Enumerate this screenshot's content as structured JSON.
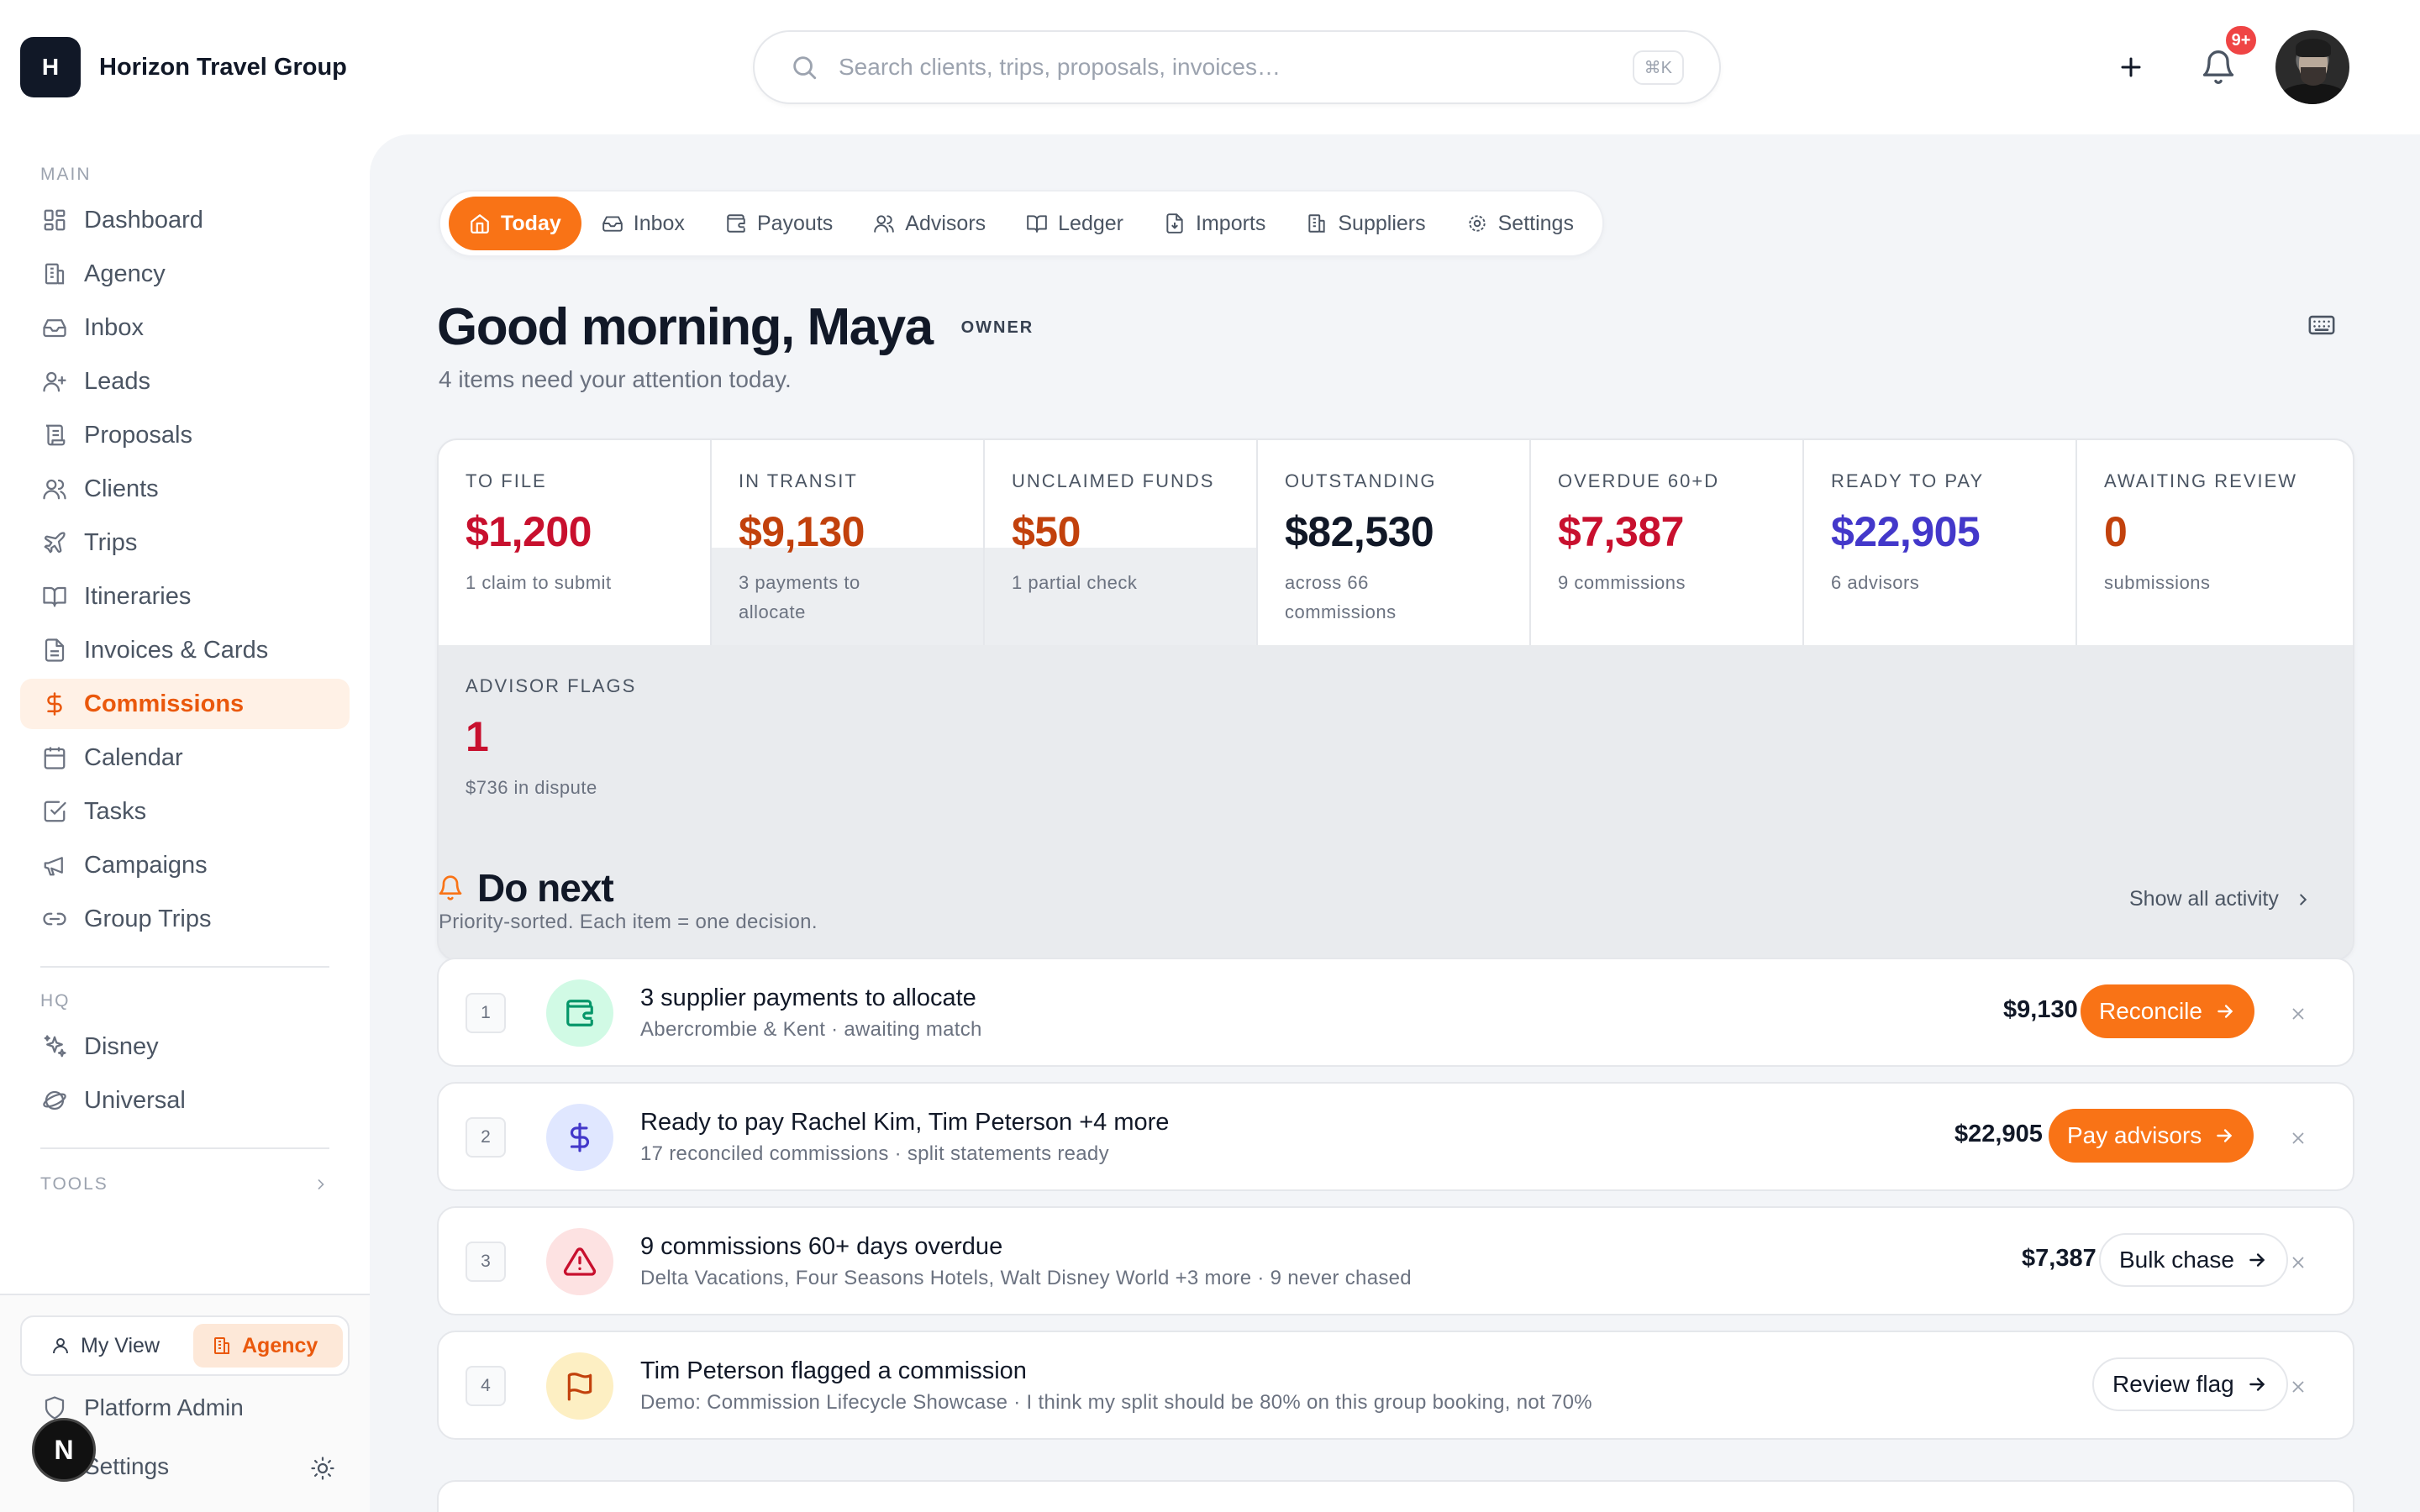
{
  "brand": {
    "logo_letter": "H",
    "name": "Horizon Travel Group"
  },
  "search": {
    "placeholder": "Search clients, trips, proposals, invoices…",
    "shortcut": "⌘K"
  },
  "notifications": {
    "badge": "9+"
  },
  "sidebar": {
    "main_label": "MAIN",
    "items": [
      {
        "label": "Dashboard",
        "icon": "dashboard-icon"
      },
      {
        "label": "Agency",
        "icon": "building-icon"
      },
      {
        "label": "Inbox",
        "icon": "inbox-icon"
      },
      {
        "label": "Leads",
        "icon": "user-plus-icon"
      },
      {
        "label": "Proposals",
        "icon": "scroll-icon"
      },
      {
        "label": "Clients",
        "icon": "users-icon"
      },
      {
        "label": "Trips",
        "icon": "plane-icon"
      },
      {
        "label": "Itineraries",
        "icon": "book-icon"
      },
      {
        "label": "Invoices & Cards",
        "icon": "document-icon"
      },
      {
        "label": "Commissions",
        "icon": "dollar-icon",
        "active": true
      },
      {
        "label": "Calendar",
        "icon": "calendar-icon"
      },
      {
        "label": "Tasks",
        "icon": "checkbox-icon"
      },
      {
        "label": "Campaigns",
        "icon": "megaphone-icon"
      },
      {
        "label": "Group Trips",
        "icon": "link-icon"
      }
    ],
    "hq_label": "HQ",
    "hq_items": [
      {
        "label": "Disney",
        "icon": "sparkles-icon"
      },
      {
        "label": "Universal",
        "icon": "globe-icon"
      }
    ],
    "tools_label": "TOOLS",
    "view_toggle": {
      "my_view": "My View",
      "agency": "Agency"
    },
    "platform_admin": "Platform Admin",
    "settings": "Settings",
    "n_badge": "N"
  },
  "tabs": [
    {
      "label": "Today",
      "icon": "home-icon",
      "active": true
    },
    {
      "label": "Inbox",
      "icon": "inbox-icon"
    },
    {
      "label": "Payouts",
      "icon": "wallet-icon"
    },
    {
      "label": "Advisors",
      "icon": "users-icon"
    },
    {
      "label": "Ledger",
      "icon": "book-icon"
    },
    {
      "label": "Imports",
      "icon": "file-import-icon"
    },
    {
      "label": "Suppliers",
      "icon": "building-icon"
    },
    {
      "label": "Settings",
      "icon": "gear-icon"
    }
  ],
  "greeting": {
    "title": "Good morning, Maya",
    "role": "OWNER",
    "subtitle": "4 items need your attention today."
  },
  "colors": {
    "accent": "#f97316",
    "red": "#c8102e",
    "amber": "#c2410c",
    "indigo": "#4338ca"
  },
  "stats": [
    {
      "label": "TO FILE",
      "value": "$1,200",
      "sub": "1 claim to submit",
      "color": "#c8102e"
    },
    {
      "label": "IN TRANSIT",
      "value": "$9,130",
      "sub": "3 payments to allocate",
      "color": "#c2410c"
    },
    {
      "label": "UNCLAIMED FUNDS",
      "value": "$50",
      "sub": "1 partial check",
      "color": "#c2410c"
    },
    {
      "label": "OUTSTANDING",
      "value": "$82,530",
      "sub": "across 66 commissions",
      "color": "#111827"
    },
    {
      "label": "OVERDUE 60+D",
      "value": "$7,387",
      "sub": "9 commissions",
      "color": "#c8102e"
    },
    {
      "label": "READY TO PAY",
      "value": "$22,905",
      "sub": "6 advisors",
      "color": "#4338ca"
    },
    {
      "label": "AWAITING REVIEW",
      "value": "0",
      "sub": "submissions",
      "color": "#c2410c"
    },
    {
      "label": "ADVISOR FLAGS",
      "value": "1",
      "sub": "$736 in dispute",
      "color": "#c8102e"
    }
  ],
  "do_next": {
    "title": "Do next",
    "subtitle": "Priority-sorted. Each item = one decision.",
    "show_all": "Show all activity",
    "tasks": [
      {
        "num": "1",
        "title": "3 supplier payments to allocate",
        "sub": "Abercrombie & Kent · awaiting match",
        "amount": "$9,130",
        "action": "Reconcile",
        "icon": "wallet-icon"
      },
      {
        "num": "2",
        "title": "Ready to pay Rachel Kim, Tim Peterson +4 more",
        "sub": "17 reconciled commissions · split statements ready",
        "amount": "$22,905",
        "action": "Pay advisors",
        "icon": "dollar-icon"
      },
      {
        "num": "3",
        "title": "9 commissions 60+ days overdue",
        "sub": "Delta Vacations, Four Seasons Hotels, Walt Disney World +3 more · 9 never chased",
        "amount": "$7,387",
        "action": "Bulk chase",
        "icon": "alert-triangle-icon"
      },
      {
        "num": "4",
        "title": "Tim Peterson flagged a commission",
        "sub": "Demo: Commission Lifecycle Showcase · I think my split should be 80% on this group booking, not 70%",
        "amount": "",
        "action": "Review flag",
        "icon": "flag-icon"
      }
    ]
  }
}
